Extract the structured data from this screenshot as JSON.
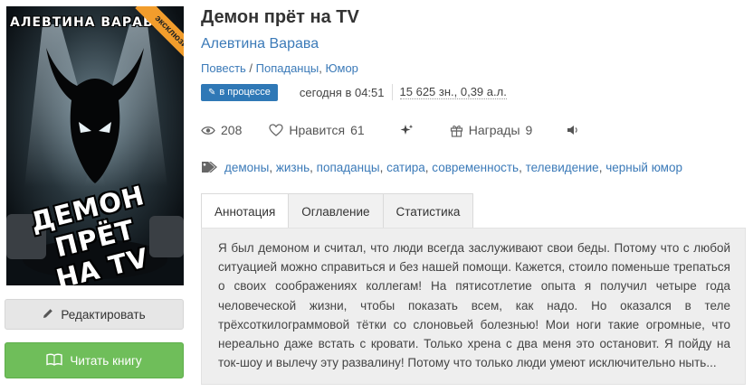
{
  "cover": {
    "author_text": "АЛЕВТИНА ВАРАВА",
    "title_line1": "ДЕМОН ПРЁТ",
    "title_line2": "НА TV",
    "ribbon": "эксклюзив"
  },
  "book": {
    "title": "Демон прёт на TV",
    "author": "Алевтина Варава",
    "genre_prefix": "Повесть",
    "genre_sep": " / ",
    "genres": [
      "Попаданцы",
      "Юмор"
    ],
    "genre_comma": ", "
  },
  "status": {
    "badge": "в процессе",
    "updated": "сегодня в 04:51",
    "size": "15 625 зн., 0,39 а.л."
  },
  "stats": {
    "views": "208",
    "likes_label": "Нравится",
    "likes": "61",
    "awards_label": "Награды",
    "awards": "9"
  },
  "tags": [
    "демоны",
    "жизнь",
    "попаданцы",
    "сатира",
    "современность",
    "телевидение",
    "черный юмор"
  ],
  "tabs": {
    "annotation": "Аннотация",
    "contents": "Оглавление",
    "statistics": "Статистика"
  },
  "annotation": "Я был демоном и считал, что люди всегда заслуживают свои беды. Потому что с любой ситуацией можно справиться и без нашей помощи. Кажется, стоило поменьше трепаться о своих соображениях коллегам! На пятисотлетие опыта я получил четыре года человеческой жизни, чтобы показать всем, как надо. Но оказался в теле трёхсоткилограммовой тётки со слоновьей болезнью! Мои ноги такие огромные, что нереально даже встать с кровати. Только хрена с два меня это остановит. Я пойду на ток-шоу и вылечу эту развалину! Потому что только люди умеют исключительно ныть...",
  "buttons": {
    "edit": "Редактировать",
    "read": "Читать книгу"
  },
  "colors": {
    "link": "#3b7ab8",
    "badge": "#2f78b6",
    "read_button": "#6fbe5a",
    "ribbon": "#f29d2c"
  }
}
